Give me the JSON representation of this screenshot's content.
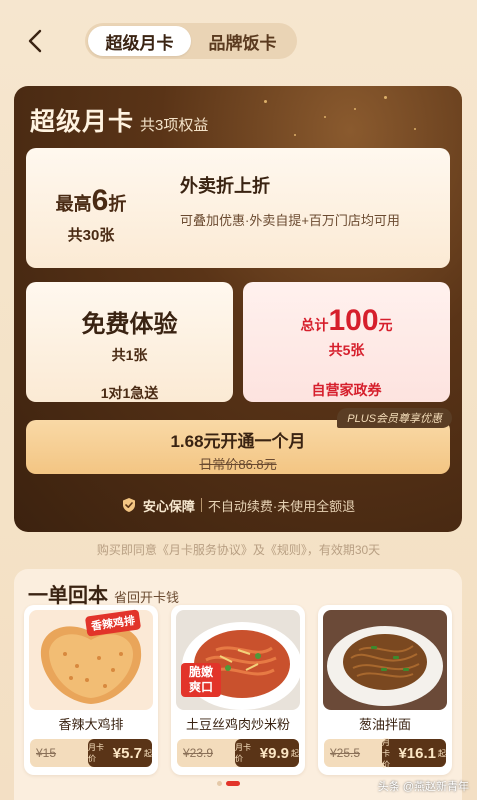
{
  "tabs": [
    {
      "label": "超级月卡"
    },
    {
      "label": "品牌饭卡"
    }
  ],
  "card": {
    "title": "超级月卡",
    "subtitle": "共3项权益",
    "top_benefit": {
      "prefix": "最高",
      "num": "6",
      "suffix": "折",
      "count": "共30张",
      "title": "外卖折上折",
      "desc": "可叠加优惠·外卖自提+百万门店均可用"
    },
    "left_benefit": {
      "title": "免费体验",
      "count": "共1张",
      "desc": "1对1急送"
    },
    "right_benefit": {
      "prefix": "总计",
      "num": "100",
      "suffix": "元",
      "count": "共5张",
      "desc": "自营家政券"
    },
    "plus_badge": "PLUS会员尊享优惠",
    "buy": {
      "label": "1.68元开通一个月",
      "original": "日常价86.8元"
    },
    "guarantee": {
      "title": "安心保障",
      "desc": "不自动续费·未使用全额退"
    }
  },
  "agreement": "购买即同意《月卡服务协议》及《规则》，有效期30天",
  "bottom": {
    "title": "一单回本",
    "subtitle": "省回开卡钱",
    "items": [
      {
        "name": "香辣大鸡排",
        "orig": "¥15",
        "card_label": "月卡价",
        "price": "¥5.7",
        "qi": "起",
        "tag": "香辣鸡排"
      },
      {
        "name": "土豆丝鸡肉炒米粉",
        "orig": "¥23.9",
        "card_label": "月卡价",
        "price": "¥9.9",
        "qi": "起",
        "tag": "脆嫩爽口"
      },
      {
        "name": "葱油拌面",
        "orig": "¥25.5",
        "card_label": "月卡价",
        "price": "¥16.1",
        "qi": "起"
      }
    ]
  },
  "watermark": "头条 @燕赵新青年",
  "colors": {
    "accent_red": "#e2342a",
    "brown_dark": "#3c220f",
    "gold": "#f3c583"
  }
}
